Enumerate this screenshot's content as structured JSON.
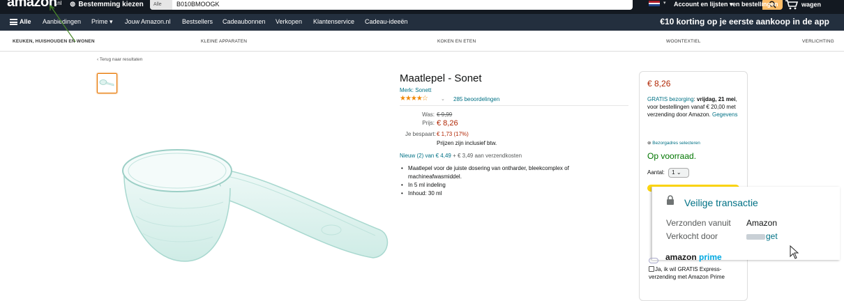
{
  "header": {
    "logo": "amazon",
    "logo_suffix": ".nl",
    "deliver_to": "Bestemming kiezen",
    "search_category": "Alle",
    "search_value": "B010BMOOGK",
    "flag_caret": "▾",
    "account_label": "Account en lijsten",
    "account_caret": "▾",
    "orders_label": "en bestellingen",
    "cart_label": "wagen"
  },
  "nav": {
    "all": "Alle",
    "items": [
      "Aanbiedingen",
      "Prime",
      "Jouw Amazon.nl",
      "Bestsellers",
      "Cadeaubonnen",
      "Verkopen",
      "Klantenservice",
      "Cadeau-ideeën"
    ],
    "prime_caret": "▾",
    "promo": "€10 korting op je eerste aankoop in de app"
  },
  "subnav": [
    "KEUKEN, HUISHOUDEN EN WONEN",
    "KLEINE APPARATEN",
    "KOKEN EN ETEN",
    "WOONTEXTIEL",
    "VERLICHTING"
  ],
  "back_link": "‹ Terug naar resultaten",
  "product": {
    "title": "Maatlepel - Sonet",
    "brand": "Merk: Sonett",
    "stars": "★★★★☆",
    "rating": 4.5,
    "stars_caret": "⌄",
    "reviews": "285 beoordelingen",
    "was_label": "Was:",
    "was_value": "€ 9,99",
    "price_label": "Prijs:",
    "price_value": "€ 8,26",
    "save_label": "Je bespaart:",
    "save_value": "€ 1,73 (17%)",
    "incl_vat": "Prijzen zijn inclusief btw.",
    "new_from_prefix": "Nieuw (2) van",
    "new_from_price": "€ 4,49",
    "new_from_suffix": "+ € 3,49 aan verzendkosten",
    "bullets": [
      "Maatlepel voor de juiste dosering van ontharder, bleekcomplex of machineafwasmiddel.",
      "In 5 ml indeling",
      "Inhoud: 30 ml"
    ]
  },
  "buybox": {
    "price": "€ 8,26",
    "delivery_link": "GRATIS bezorging",
    "delivery_colon": ":",
    "delivery_date": "vrijdag, 21 mei",
    "delivery_rest": ", voor bestellingen vanaf € 20,00 met verzending door Amazon.",
    "details_link": "Gegevens",
    "address": "Bezorgadres selecteren",
    "stock": "Op voorraad.",
    "qty_label": "Aantal:",
    "qty_value": "1",
    "qty_caret": "⌄",
    "prime_word_a": "amazon ",
    "prime_word_b": "prime",
    "prime_check": "Ja, ik wil GRATIS Express-verzending met Amazon Prime"
  },
  "popup": {
    "title": "Veilige transactie",
    "shipped_label": "Verzonden vanuit",
    "shipped_value": "Amazon",
    "sold_label": "Verkocht door",
    "sold_value": "get"
  },
  "colors": {
    "topbar": "#131921",
    "navbar": "#232f3e",
    "link": "#007185",
    "price": "#b12704",
    "stock": "#007600",
    "search_button": "#febd69"
  }
}
